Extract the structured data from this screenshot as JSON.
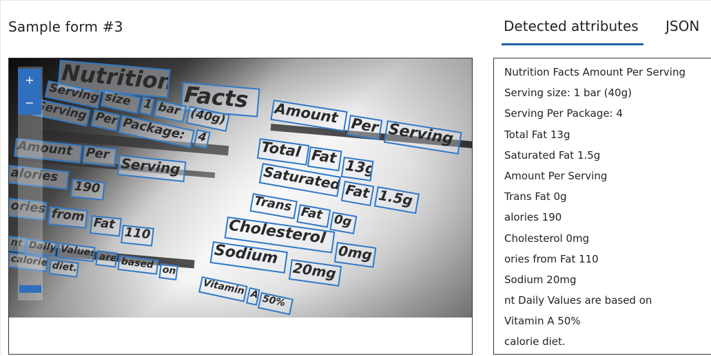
{
  "header": {
    "title": "Sample form #3"
  },
  "tabs": [
    {
      "label": "Detected attributes",
      "active": true
    },
    {
      "label": "JSON",
      "active": false
    }
  ],
  "zoom": {
    "in_label": "+",
    "out_label": "−"
  },
  "accent_color": "#2e78c7",
  "ocr_words": [
    "Nutrition",
    "Facts",
    "Serving",
    "size",
    "1",
    "bar",
    "(40g)",
    "Serving",
    "Per",
    "Package:",
    "4",
    "Amount",
    "Per",
    "Serving",
    "Amount",
    "Per",
    "Serving",
    "Total",
    "Fat",
    "13g",
    "alories",
    "190",
    "Saturated",
    "Fat",
    "1.5g",
    "Trans",
    "Fat",
    "0g",
    "ories",
    "from",
    "Fat",
    "110",
    "Cholesterol",
    "0mg",
    "nt",
    "Daily",
    "Values",
    "are",
    "based",
    "on",
    "Sodium",
    "20mg",
    "calorie",
    "diet.",
    "Vitamin",
    "A",
    "50%"
  ],
  "detected_attributes": [
    "Nutrition Facts Amount Per Serving",
    "Serving size: 1 bar (40g)",
    "Serving Per Package: 4",
    "Total Fat 13g",
    "Saturated Fat 1.5g",
    "Amount Per Serving",
    "Trans Fat 0g",
    "alories 190",
    "Cholesterol 0mg",
    "ories from Fat 110",
    "Sodium 20mg",
    "nt Daily Values are based on",
    "Vitamin A 50%",
    "calorie diet."
  ]
}
